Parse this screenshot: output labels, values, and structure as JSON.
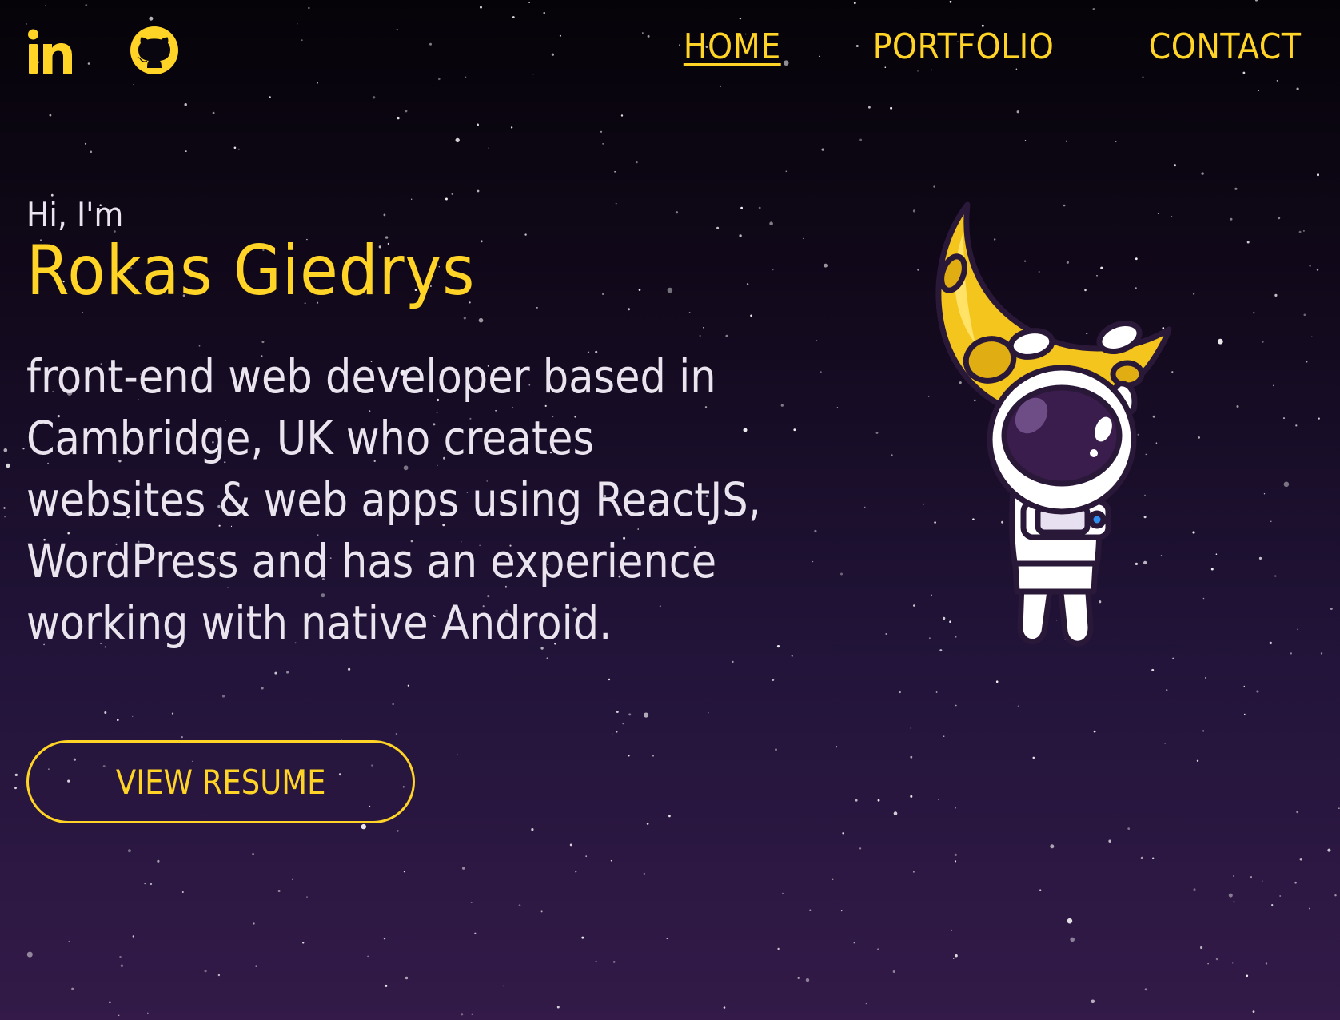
{
  "colors": {
    "accent": "#FFD426",
    "text": "#E9E4EE",
    "background_top": "#050308",
    "background_bottom": "#331a48"
  },
  "header": {
    "social": [
      {
        "name": "LinkedIn",
        "icon": "linkedin-icon"
      },
      {
        "name": "GitHub",
        "icon": "github-icon"
      }
    ],
    "nav": [
      {
        "label": "HOME",
        "active": true
      },
      {
        "label": "PORTFOLIO",
        "active": false
      },
      {
        "label": "CONTACT",
        "active": false
      }
    ]
  },
  "hero": {
    "greeting": "Hi, I'm",
    "name": "Rokas Giedrys",
    "bio": "front-end web developer based in Cambridge, UK who creates websites & web apps using ReactJS, WordPress and has an experience working with native Android.",
    "button_label": "VIEW RESUME",
    "illustration": "astronaut-holding-moon"
  }
}
